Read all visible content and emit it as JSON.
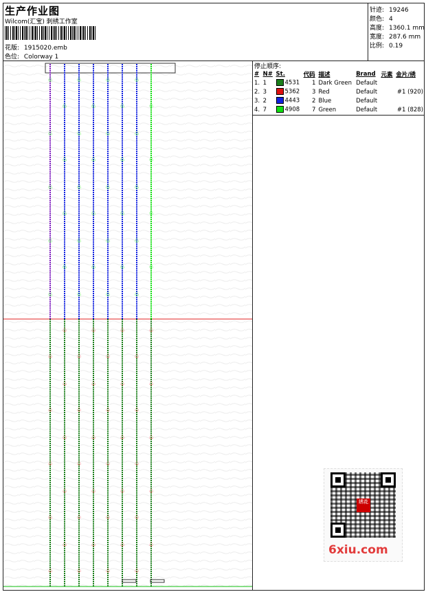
{
  "header": {
    "title": "生产作业图",
    "studio": "Wilcom(汇宝) 刺绣工作室",
    "design_label": "花版:",
    "design_value": "1915020.emb",
    "colorway_label": "色位:",
    "colorway_value": "Colorway 1"
  },
  "stats": [
    {
      "label": "针迹:",
      "value": "19246"
    },
    {
      "label": "颜色:",
      "value": "4"
    },
    {
      "label": "高度:",
      "value": "1360.1 mm"
    },
    {
      "label": "宽度:",
      "value": "287.6 mm"
    },
    {
      "label": "比例:",
      "value": "0.19"
    }
  ],
  "stop_sequence": {
    "title": "停止顺序:",
    "columns": [
      "#",
      "N#",
      "St.",
      "代码",
      "描述",
      "Brand",
      "元素",
      "金片/绣"
    ],
    "rows": [
      {
        "num": "1.",
        "n": "1",
        "color": "#1a7f1a",
        "st": "4531",
        "code": "1",
        "desc": "Dark Green",
        "brand": "Default",
        "element": "",
        "sequin": ""
      },
      {
        "num": "2.",
        "n": "3",
        "color": "#e01010",
        "st": "5362",
        "code": "3",
        "desc": "Red",
        "brand": "Default",
        "element": "",
        "sequin": "#1 (920)"
      },
      {
        "num": "3.",
        "n": "2",
        "color": "#1020e0",
        "st": "4443",
        "code": "2",
        "desc": "Blue",
        "brand": "Default",
        "element": "",
        "sequin": ""
      },
      {
        "num": "4.",
        "n": "7",
        "color": "#10e010",
        "st": "4908",
        "code": "7",
        "desc": "Green",
        "brand": "Default",
        "element": "",
        "sequin": "#1 (828)"
      }
    ]
  },
  "watermark": {
    "site": "6xiu.com",
    "qr_badge": "绣花"
  }
}
